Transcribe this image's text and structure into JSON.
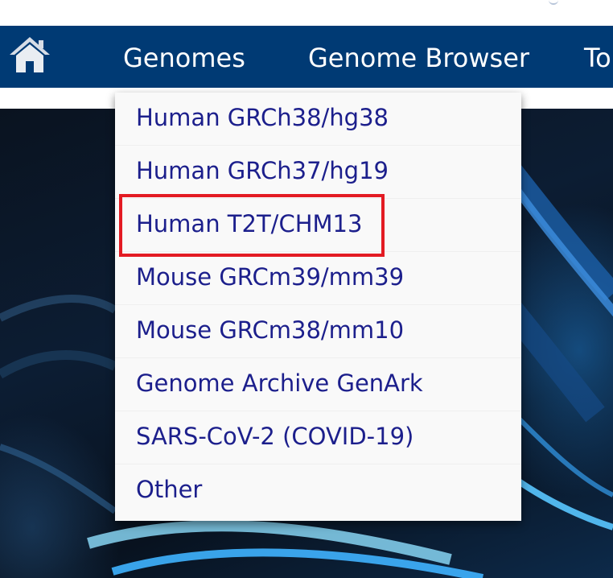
{
  "navbar": {
    "home_icon": "house-icon",
    "items": [
      "Genomes",
      "Genome Browser",
      "To"
    ]
  },
  "genomes_menu": {
    "items": [
      "Human GRCh38/hg38",
      "Human GRCh37/hg19",
      "Human T2T/CHM13",
      "Mouse GRCm39/mm39",
      "Mouse GRCm38/mm10",
      "Genome Archive GenArk",
      "SARS-CoV-2 (COVID-19)",
      "Other"
    ],
    "highlighted_item": "Human T2T/CHM13"
  },
  "colors": {
    "navbar_bg": "#003a74",
    "nav_text": "#ffffff",
    "menu_text": "#1c1f8c",
    "menu_bg": "#f9f9f9",
    "highlight": "#e31b23"
  }
}
